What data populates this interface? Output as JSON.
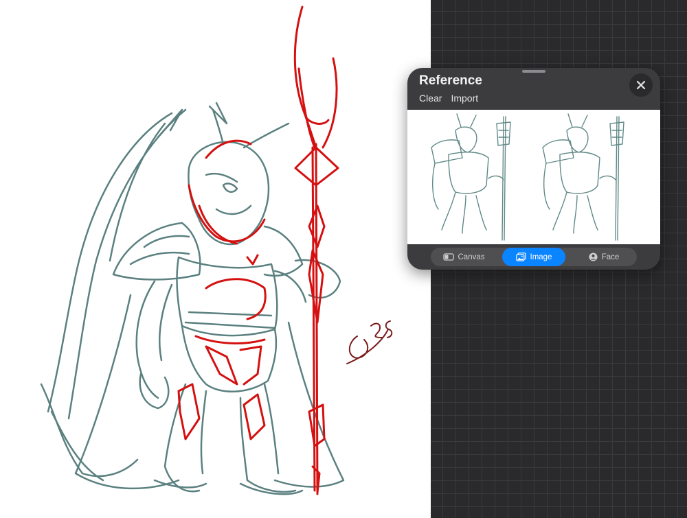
{
  "reference_panel": {
    "title": "Reference",
    "actions": {
      "clear": "Clear",
      "import": "Import"
    },
    "modes": [
      {
        "label": "Canvas",
        "icon": "canvas-icon",
        "active": false
      },
      {
        "label": "Image",
        "icon": "image-icon",
        "active": true
      },
      {
        "label": "Face",
        "icon": "face-icon",
        "active": false
      }
    ]
  },
  "colors": {
    "accent": "#0a84ff",
    "sketch_teal": "#3f6b6a",
    "sketch_red": "#d41010",
    "signature": "#7a1a1a",
    "panel_bg": "#3c3c3e",
    "canvas_dark": "#2a2a2c"
  }
}
